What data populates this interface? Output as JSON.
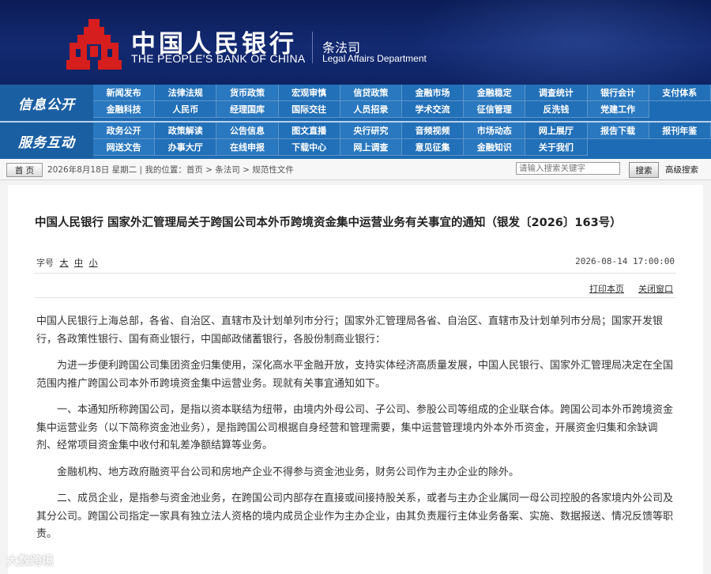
{
  "header": {
    "bank_cn": "中国人民银行",
    "bank_en": "THE PEOPLE'S BANK OF CHINA",
    "dept_cn": "条法司",
    "dept_en": "Legal Affairs Department"
  },
  "nav": {
    "section1_label": "信息公开",
    "section1_items": [
      "新闻发布",
      "法律法规",
      "货币政策",
      "宏观审慎",
      "信贷政策",
      "金融市场",
      "金融稳定",
      "调查统计",
      "银行会计",
      "支付体系",
      "金融科技",
      "人民币",
      "经理国库",
      "国际交往",
      "人员招录",
      "学术交流",
      "征信管理",
      "反洗钱",
      "党建工作"
    ],
    "section2_label": "服务互动",
    "section2_items": [
      "政务公开",
      "政策解读",
      "公告信息",
      "图文直播",
      "央行研究",
      "音频视频",
      "市场动态",
      "网上展厅",
      "报告下载",
      "报刊年鉴",
      "网送文告",
      "办事大厅",
      "在线申报",
      "下载中心",
      "网上调查",
      "意见征集",
      "金融知识",
      "关于我们"
    ]
  },
  "crumbbar": {
    "home": "首 页",
    "crumb": "2026年8月18日  星期二  |  我的位置：首页  >  条法司  >  规范性文件",
    "search_placeholder": "请输入搜索关键字",
    "search_button": "搜索",
    "advanced": "高级搜索"
  },
  "article": {
    "title": "中国人民银行 国家外汇管理局关于跨国公司本外币跨境资金集中运营业务有关事宜的通知（银发〔2026〕163号）",
    "fontsize_label": "字号",
    "fontsize_large": "大",
    "fontsize_medium": "中",
    "fontsize_small": "小",
    "date": "2026-08-14 17:00:00",
    "print": "打印本页",
    "close": "关闭窗口",
    "paragraphs": [
      "中国人民银行上海总部，各省、自治区、直辖市及计划单列市分行；国家外汇管理局各省、自治区、直辖市及计划单列市分局；国家开发银行，各政策性银行、国有商业银行，中国邮政储蓄银行，各股份制商业银行：",
      "为进一步便利跨国公司集团资金归集使用，深化高水平金融开放，支持实体经济高质量发展，中国人民银行、国家外汇管理局决定在全国范围内推广跨国公司本外币跨境资金集中运营业务。现就有关事宜通知如下。",
      "一、本通知所称跨国公司，是指以资本联结为纽带，由境内外母公司、子公司、参股公司等组成的企业联合体。跨国公司本外币跨境资金集中运营业务（以下简称资金池业务），是指跨国公司根据自身经营和管理需要，集中运营管理境内外本外币资金，开展资金归集和余缺调剂、经常项目资金集中收付和轧差净额结算等业务。",
      "金融机构、地方政府融资平台公司和房地产企业不得参与资金池业务，财务公司作为主办企业的除外。",
      "二、成员企业，是指参与资金池业务，在跨国公司内部存在直接或间接持股关系，或者与主办企业属同一母公司控股的各家境内外公司及其分公司。跨国公司指定一家具有独立法人资格的境内成员企业作为主办企业，由其负责履行主体业务备案、实施、数据报送、情况反馈等职责。"
    ]
  },
  "watermark": "大数跨境",
  "colors": {
    "header_bg": "#0e2363",
    "nav_bg": "#2a78bf",
    "logo_red": "#d71e1e"
  }
}
